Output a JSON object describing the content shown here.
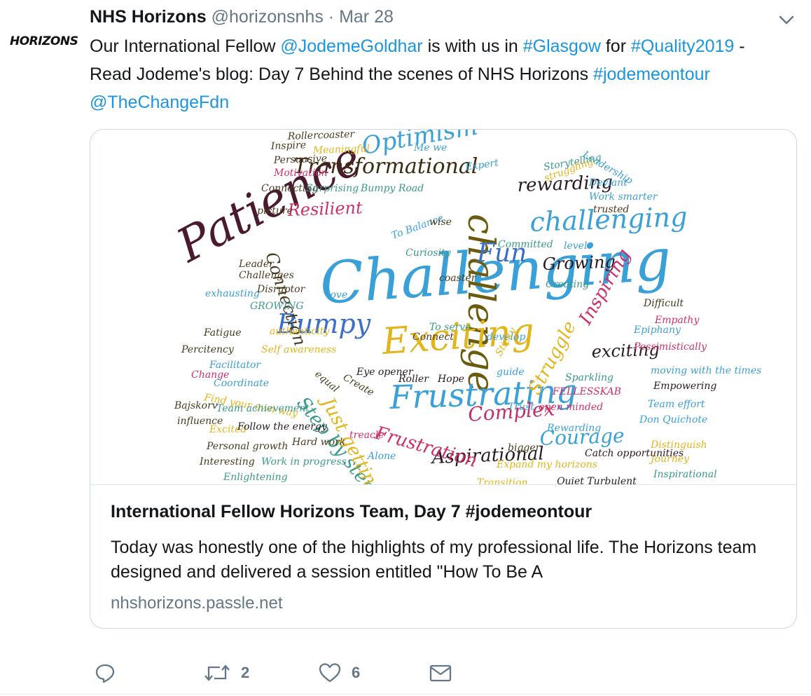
{
  "tweet": {
    "avatar_text": "HORIZONS",
    "author_name": "NHS Horizons",
    "author_handle": "@horizonsnhs",
    "separator": "·",
    "date": "Mar 28",
    "text_parts": [
      {
        "t": "Our International Fellow ",
        "link": false
      },
      {
        "t": "@JodemeGoldhar",
        "link": true
      },
      {
        "t": " is with us in ",
        "link": false
      },
      {
        "t": "#Glasgow",
        "link": true
      },
      {
        "t": " for ",
        "link": false
      },
      {
        "t": "#Quality2019",
        "link": true
      },
      {
        "t": " -  Read Jodeme's blog: Day 7 Behind the scenes of NHS Horizons ",
        "link": false
      },
      {
        "t": "#jodemeontour",
        "link": true
      },
      {
        "t": " ",
        "link": false
      },
      {
        "t": "@TheChangeFdn",
        "link": true
      }
    ]
  },
  "card": {
    "title": "International Fellow Horizons Team, Day 7 #jodemeontour",
    "description": "Today was honestly one of the highlights of my professional life.  The Horizons team designed and delivered a session entitled \"How To Be A",
    "domain": "nhshorizons.passle.net"
  },
  "actions": {
    "reply_count": "",
    "retweet_count": "2",
    "like_count": "6"
  },
  "colors": {
    "link": "#1b95e0",
    "secondary": "#657786",
    "border": "#ccd6dd"
  },
  "icons": {
    "caret": "chevron-down-icon",
    "reply": "reply-icon",
    "retweet": "retweet-icon",
    "like": "heart-icon",
    "dm": "envelope-icon"
  },
  "wordcloud": [
    {
      "t": "Challenging",
      "c": "#3aa0d8"
    },
    {
      "t": "Patience",
      "c": "#4a1a2e"
    },
    {
      "t": "challenge",
      "c": "#6b5b0e"
    },
    {
      "t": "Exciting",
      "c": "#e2b51a"
    },
    {
      "t": "Frustrating",
      "c": "#3aa0d8"
    },
    {
      "t": "Bumpy",
      "c": "#3a6fc8"
    },
    {
      "t": "challenging",
      "c": "#3aa0d8"
    },
    {
      "t": "Fun",
      "c": "#3a6fc8"
    },
    {
      "t": "Transformational",
      "c": "#3b2b10"
    },
    {
      "t": "Optimism",
      "c": "#3aa0d8"
    },
    {
      "t": "rewarding",
      "c": "#2a1a20"
    },
    {
      "t": "Growing",
      "c": "#2a1a20"
    },
    {
      "t": "Resilient",
      "c": "#d0306a"
    },
    {
      "t": "Connection",
      "c": "#4a3a20"
    },
    {
      "t": "Complex",
      "c": "#c0306a"
    },
    {
      "t": "Aspirational",
      "c": "#2a1a20"
    },
    {
      "t": "Courage",
      "c": "#3aa0d8"
    },
    {
      "t": "Frustration",
      "c": "#d0306a"
    },
    {
      "t": "Struggle",
      "c": "#e2b51a"
    },
    {
      "t": "Inspiring",
      "c": "#d0306a"
    },
    {
      "t": "exciting",
      "c": "#2a1a20"
    },
    {
      "t": "Step by step",
      "c": "#3a9a8a"
    },
    {
      "t": "Just getting",
      "c": "#e2b51a"
    },
    {
      "t": "Rollercoaster",
      "c": "#4a3a20"
    },
    {
      "t": "Inspire",
      "c": "#4a3a20"
    },
    {
      "t": "Meaningful",
      "c": "#e2b51a"
    },
    {
      "t": "Persuasive",
      "c": "#4a3a20"
    },
    {
      "t": "Motivation",
      "c": "#d0306a"
    },
    {
      "t": "Connecting",
      "c": "#4a3a20"
    },
    {
      "t": "Surprising",
      "c": "#3a9a8a"
    },
    {
      "t": "Bumpy Road",
      "c": "#3a9a8a"
    },
    {
      "t": "picture",
      "c": "#4a3a20"
    },
    {
      "t": "Expert",
      "c": "#3aa0d8"
    },
    {
      "t": "Storytelling",
      "c": "#3a9a8a"
    },
    {
      "t": "Leadership",
      "c": "#3aa0d8"
    },
    {
      "t": "struggling",
      "c": "#e2b51a"
    },
    {
      "t": "Deviant",
      "c": "#3aa0d8"
    },
    {
      "t": "Work smarter",
      "c": "#3aa0d8"
    },
    {
      "t": "trusted",
      "c": "#4a3a20"
    },
    {
      "t": "Committed",
      "c": "#3a9a8a"
    },
    {
      "t": "level",
      "c": "#3aa0d8"
    },
    {
      "t": "Curiosity",
      "c": "#3a9a8a"
    },
    {
      "t": "To Balance",
      "c": "#3aa0d8"
    },
    {
      "t": "Leader",
      "c": "#4a3a20"
    },
    {
      "t": "Challenges",
      "c": "#4a3a20"
    },
    {
      "t": "exhausting",
      "c": "#3aa0d8"
    },
    {
      "t": "Disruptor",
      "c": "#4a3a20"
    },
    {
      "t": "GROWING",
      "c": "#3a9a8a"
    },
    {
      "t": "Creating",
      "c": "#3a9a8a"
    },
    {
      "t": "Difficult",
      "c": "#4a3a20"
    },
    {
      "t": "Empathy",
      "c": "#d0306a"
    },
    {
      "t": "Epiphany",
      "c": "#3aa0d8"
    },
    {
      "t": "Pessimistically",
      "c": "#d0306a"
    },
    {
      "t": "Fatigue",
      "c": "#4a3a20"
    },
    {
      "t": "authenticity",
      "c": "#e2b51a"
    },
    {
      "t": "Percitency",
      "c": "#4a3a20"
    },
    {
      "t": "Self awareness",
      "c": "#e2b51a"
    },
    {
      "t": "Change",
      "c": "#d0306a"
    },
    {
      "t": "Facilitator",
      "c": "#3aa0d8"
    },
    {
      "t": "Coordinate",
      "c": "#3aa0d8"
    },
    {
      "t": "Find your own way",
      "c": "#e2b51a"
    },
    {
      "t": "Team achievement",
      "c": "#3a9a8a"
    },
    {
      "t": "Bajskorv",
      "c": "#4a3a20"
    },
    {
      "t": "influence",
      "c": "#4a3a20"
    },
    {
      "t": "Excited",
      "c": "#e2b51a"
    },
    {
      "t": "Follow the energy",
      "c": "#2a1a20"
    },
    {
      "t": "Personal growth",
      "c": "#4a3a20"
    },
    {
      "t": "Hard work",
      "c": "#4a3a20"
    },
    {
      "t": "Interesting",
      "c": "#4a3a20"
    },
    {
      "t": "Work in progress",
      "c": "#3a9a8a"
    },
    {
      "t": "Enlightening",
      "c": "#3a9a8a"
    },
    {
      "t": "To serve",
      "c": "#3a9a8a"
    },
    {
      "t": "Connect",
      "c": "#4a3a20"
    },
    {
      "t": "develop",
      "c": "#3aa0d8"
    },
    {
      "t": "Eye opener",
      "c": "#2a1a20"
    },
    {
      "t": "Roller",
      "c": "#2a1a20"
    },
    {
      "t": "Hope",
      "c": "#2a1a20"
    },
    {
      "t": "Sparkling",
      "c": "#3a9a8a"
    },
    {
      "t": "FELLESSKAB",
      "c": "#d0306a"
    },
    {
      "t": "open minded",
      "c": "#d0306a"
    },
    {
      "t": "Rewarding",
      "c": "#3aa0d8"
    },
    {
      "t": "Catch opportunities",
      "c": "#2a1a20"
    },
    {
      "t": "moving with the times",
      "c": "#3aa0d8"
    },
    {
      "t": "Empowering",
      "c": "#2a1a20"
    },
    {
      "t": "Team effort",
      "c": "#3aa0d8"
    },
    {
      "t": "Don Quichote",
      "c": "#3aa0d8"
    },
    {
      "t": "Distinguish",
      "c": "#e2b51a"
    },
    {
      "t": "Journey",
      "c": "#e2b51a"
    },
    {
      "t": "Inspirational",
      "c": "#3a9a8a"
    },
    {
      "t": "Expand my horizons",
      "c": "#e2b51a"
    },
    {
      "t": "bigger",
      "c": "#4a3a20"
    },
    {
      "t": "treacle",
      "c": "#d0306a"
    },
    {
      "t": "Alone",
      "c": "#3aa0d8"
    },
    {
      "t": "Trust",
      "c": "#3aa0d8"
    },
    {
      "t": "guide",
      "c": "#3aa0d8"
    },
    {
      "t": "Sticky",
      "c": "#e2b51a"
    },
    {
      "t": "Transition",
      "c": "#e2b51a"
    },
    {
      "t": "Quiet Turbulent",
      "c": "#2a1a20"
    },
    {
      "t": "love",
      "c": "#3aa0d8"
    },
    {
      "t": "coaster",
      "c": "#4a3a20"
    },
    {
      "t": "wise",
      "c": "#4a3a20"
    },
    {
      "t": "Me we",
      "c": "#3aa0d8"
    },
    {
      "t": "equal",
      "c": "#4a3a20"
    },
    {
      "t": "Create",
      "c": "#4a3a20"
    }
  ]
}
